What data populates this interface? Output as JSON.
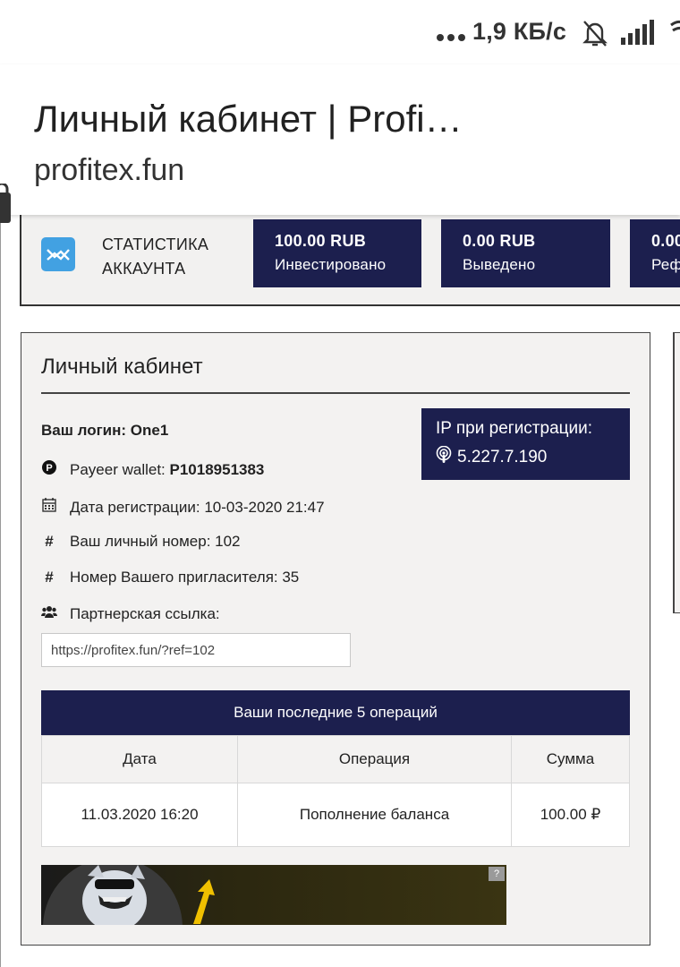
{
  "status_bar": {
    "speed": "1,9 КБ/с",
    "icons": [
      "dots-icon",
      "bell-off-icon",
      "signal-icon",
      "wifi-icon"
    ]
  },
  "browser": {
    "title": "Личный кабинет | Profi…",
    "url": "profitex.fun"
  },
  "stats": {
    "label_line1": "СТАТИСТИКА",
    "label_line2": "АККАУНТА",
    "boxes": [
      {
        "value": "100.00 RUB",
        "label": "Инвестировано"
      },
      {
        "value": "0.00 RUB",
        "label": "Выведено"
      },
      {
        "value": "0.00",
        "label": "Реф"
      }
    ]
  },
  "cabinet": {
    "heading": "Личный кабинет",
    "login_label": "Ваш логин: One1",
    "payeer_label": "Payeer wallet: ",
    "payeer_value": "P1018951383",
    "reg_date": "Дата регистрации: 10-03-2020 21:47",
    "personal_number": "Ваш личный номер: 102",
    "inviter_number": "Номер Вашего пригласителя: 35",
    "partner_link_label": "Партнерская ссылка:",
    "partner_link": "https://profitex.fun/?ref=102",
    "ip_label": "IP при регистрации:",
    "ip_value": "5.227.7.190"
  },
  "operations": {
    "title": "Ваши последние 5 операций",
    "columns": [
      "Дата",
      "Операция",
      "Сумма"
    ],
    "rows": [
      {
        "date": "11.03.2020 16:20",
        "operation": "Пополнение баланса",
        "amount": "100.00 ₽"
      }
    ]
  },
  "banner": {
    "badge": "?"
  },
  "colors": {
    "navy": "#1c1f4e",
    "panel": "#f3f2f1",
    "accent": "#42a1e2"
  }
}
